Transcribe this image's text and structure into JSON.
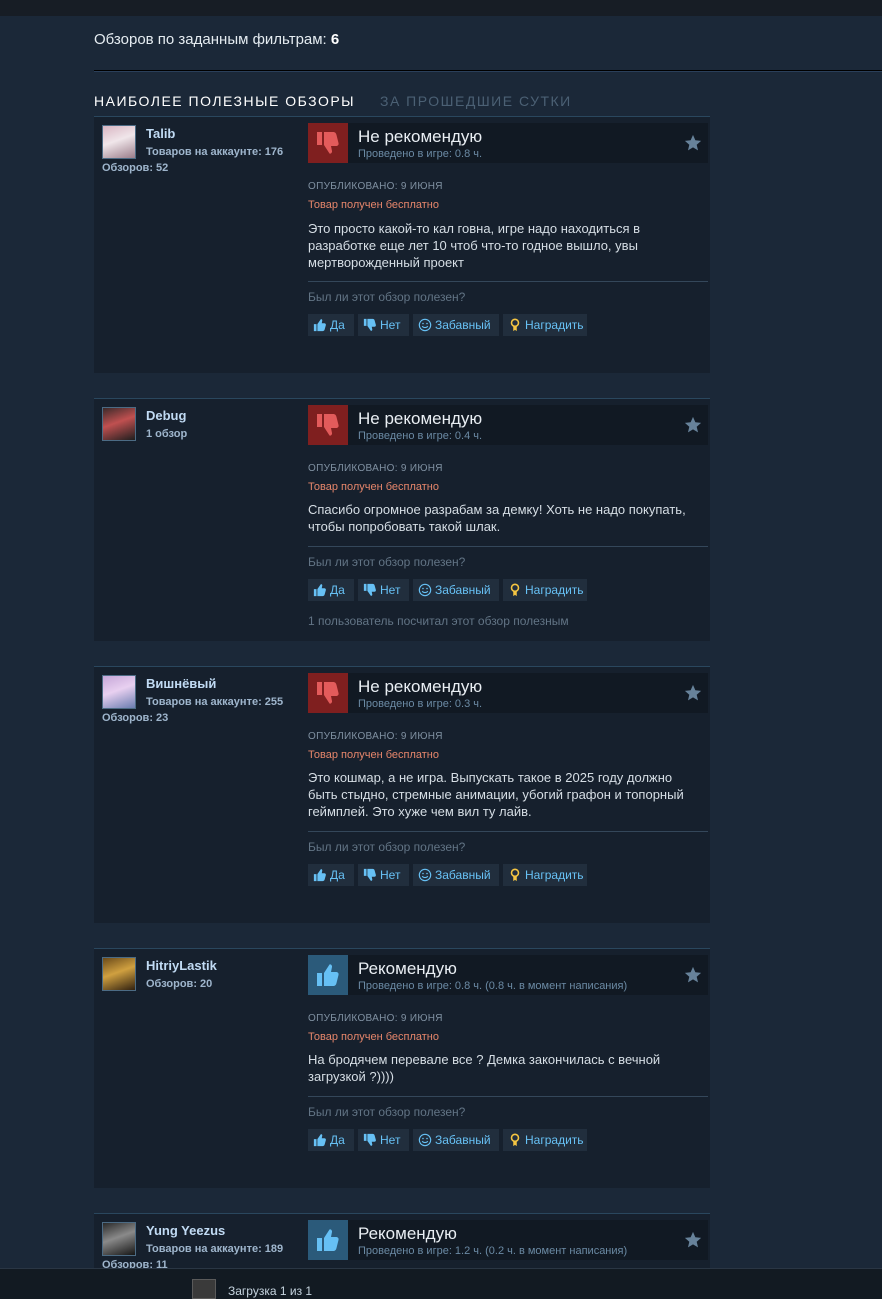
{
  "filter": {
    "label": "Обзоров по заданным фильтрам:",
    "count": "6"
  },
  "section": {
    "title": "НАИБОЛЕЕ ПОЛЕЗНЫЕ ОБЗОРЫ",
    "subtitle": "ЗА ПРОШЕДШИЕ СУТКИ"
  },
  "helpful_question": "Был ли этот обзор полезен?",
  "buttons": {
    "yes": "Да",
    "no": "Нет",
    "funny": "Забавный",
    "award": "Наградить"
  },
  "colors": {
    "background": "#1b2838",
    "panel": "#16202d",
    "negative_thumb": "#7f1f1f",
    "positive_thumb": "#2b5a7a",
    "link_blue": "#67c1f5",
    "free_orange": "#e6866b"
  },
  "reviews": [
    {
      "username": "Talib",
      "stat1": "Товаров на аккаунте: 176",
      "stat2": "Обзоров: 52",
      "recommended": false,
      "verdict": "Не рекомендую",
      "playtime": "Проведено в игре: 0.8 ч.",
      "posted": "ОПУБЛИКОВАНО: 9 ИЮНЯ",
      "free": "Товар получен бесплатно",
      "content": "Это просто какой-то кал говна, игре надо находиться в разработке еще лет 10 чтоб что-то годное вышло, увы мертворожденный проект",
      "found_helpful": ""
    },
    {
      "username": "Debug",
      "stat1": "1 обзор",
      "stat2": "",
      "recommended": false,
      "verdict": "Не рекомендую",
      "playtime": "Проведено в игре: 0.4 ч.",
      "posted": "ОПУБЛИКОВАНО: 9 ИЮНЯ",
      "free": "Товар получен бесплатно",
      "content": "Спасибо огромное разрабам за демку! Хоть не надо покупать, чтобы попробовать такой шлак.",
      "found_helpful": "1 пользователь посчитал этот обзор полезным"
    },
    {
      "username": "Вишнёвый",
      "stat1": "Товаров на аккаунте: 255",
      "stat2": "Обзоров: 23",
      "recommended": false,
      "verdict": "Не рекомендую",
      "playtime": "Проведено в игре: 0.3 ч.",
      "posted": "ОПУБЛИКОВАНО: 9 ИЮНЯ",
      "free": "Товар получен бесплатно",
      "content": "Это кошмар, а не игра. Выпускать такое в 2025 году должно быть стыдно, стремные анимации, убогий графон и топорный геймплей. Это хуже чем вил ту лайв.",
      "found_helpful": ""
    },
    {
      "username": "HitriyLastik",
      "stat1": "Обзоров: 20",
      "stat2": "",
      "recommended": true,
      "verdict": "Рекомендую",
      "playtime": "Проведено в игре: 0.8 ч. (0.8 ч. в момент написания)",
      "posted": "ОПУБЛИКОВАНО: 9 ИЮНЯ",
      "free": "Товар получен бесплатно",
      "content": "На бродячем перевале все ? Демка закончилась с вечной загрузкой ?))))",
      "found_helpful": ""
    },
    {
      "username": "Yung Yeezus",
      "stat1": "Товаров на аккаунте: 189",
      "stat2": "Обзоров: 11",
      "recommended": true,
      "verdict": "Рекомендую",
      "playtime": "Проведено в игре: 1.2 ч. (0.2 ч. в момент написания)",
      "posted": "",
      "free": "",
      "content": "",
      "found_helpful": ""
    }
  ],
  "footer": {
    "loading": "Загрузка 1 из 1"
  }
}
